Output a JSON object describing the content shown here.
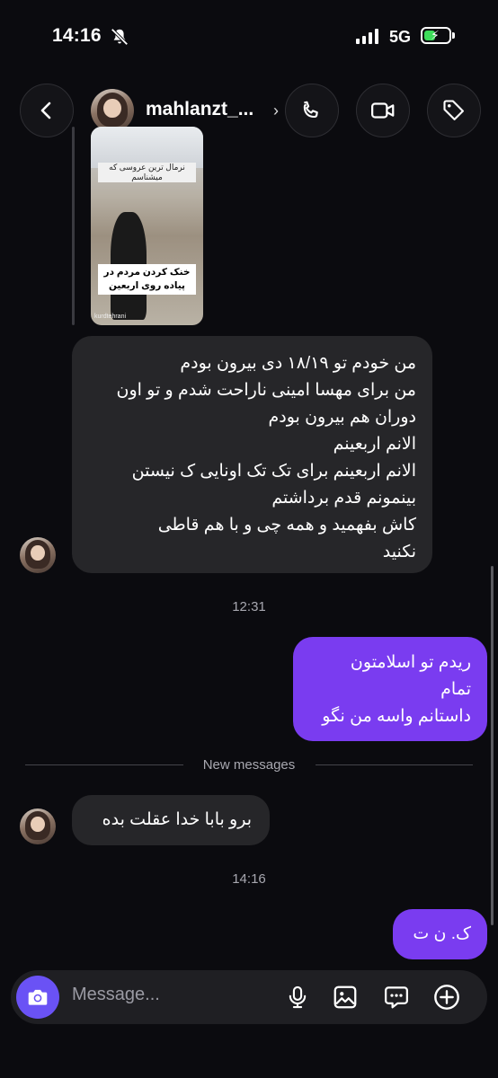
{
  "status_bar": {
    "time": "14:16",
    "network": "5G"
  },
  "header": {
    "username": "mahlanzt_..."
  },
  "media": {
    "top_text": "نرمال ترین عروسی که میشناسم",
    "caption_line1": "خنک کردن مردم در",
    "caption_line2": "پیاده روی اربعین",
    "credit": "kurdtehrani"
  },
  "messages": {
    "incoming_1": [
      "من خودم تو ۱۸/۱۹ دی بیرون بودم",
      "من برای مهسا امینی ناراحت شدم و تو اون",
      "دوران هم بیرون بودم",
      "الانم اربعینم",
      "الانم اربعینم برای تک تک اونایی ک نیستن",
      "بینمونم قدم برداشتم",
      "کاش بفهمید و همه چی و با هم قاطی",
      "نکنید"
    ],
    "time_1": "12:31",
    "outgoing_1": [
      "ریدم تو اسلامتون",
      "تمام",
      "داستانم واسه من نگو"
    ],
    "new_messages_label": "New messages",
    "incoming_2": "برو بابا خدا عقلت بده",
    "time_2": "14:16",
    "outgoing_2": "ک. ن ت"
  },
  "composer": {
    "placeholder": "Message..."
  },
  "colors": {
    "accent": "#7a3cf0",
    "camera": "#6a52f5",
    "bubble_in": "#262629",
    "background": "#0b0b0f"
  }
}
